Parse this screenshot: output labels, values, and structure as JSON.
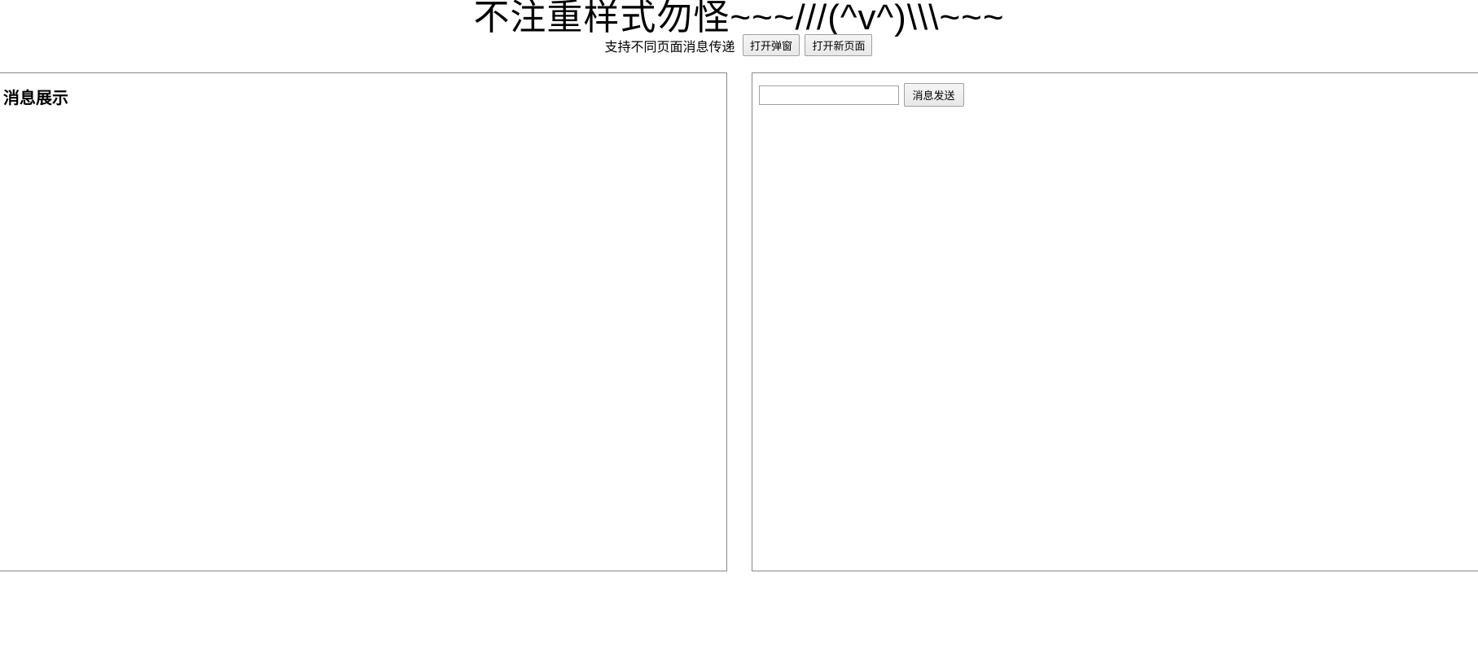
{
  "header": {
    "title": "不注重样式勿怪~~~///(^v^)\\\\\\~~~",
    "subtitle": "支持不同页面消息传递",
    "open_popup_label": "打开弹窗",
    "open_new_page_label": "打开新页面"
  },
  "left_panel": {
    "heading": "消息展示"
  },
  "right_panel": {
    "input_value": "",
    "send_label": "消息发送"
  }
}
